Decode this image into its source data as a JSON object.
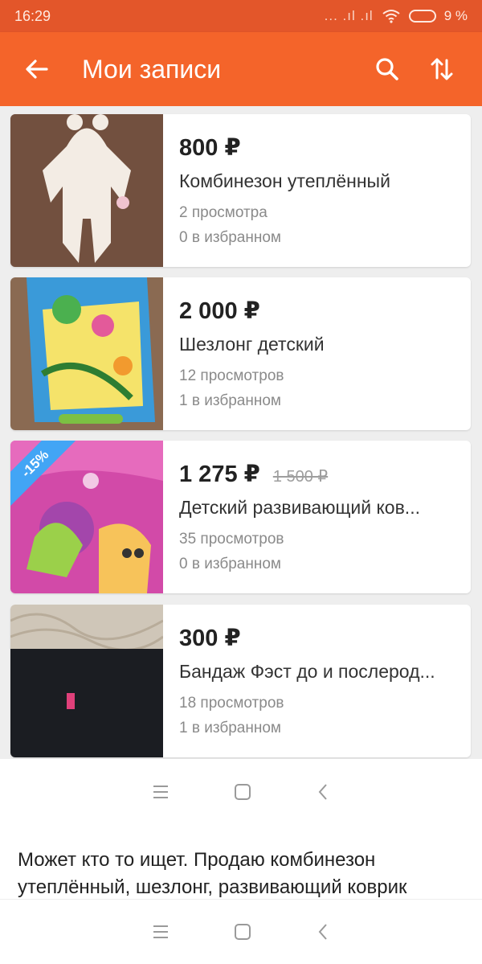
{
  "status_bar": {
    "time": "16:29",
    "signal": "... .ıl .ıl",
    "battery": "9 %"
  },
  "app_bar": {
    "title": "Мои записи",
    "icons": [
      "arrow-back-icon",
      "search-icon",
      "sort-icon"
    ]
  },
  "items": [
    {
      "price": "800 ₽",
      "old_price": "",
      "name": "Комбинезон утеплённый",
      "views": "2 просмотра",
      "favorites": "0 в избранном",
      "discount": ""
    },
    {
      "price": "2 000 ₽",
      "old_price": "",
      "name": "Шезлонг детский",
      "views": "12 просмотров",
      "favorites": "1 в избранном",
      "discount": ""
    },
    {
      "price": "1 275 ₽",
      "old_price": "1 500 ₽",
      "name": "Детский развивающий ков...",
      "views": "35 просмотров",
      "favorites": "0 в избранном",
      "discount": "-15%"
    },
    {
      "price": "300 ₽",
      "old_price": "",
      "name": "Бандаж Фэст до и послерод...",
      "views": "18 просмотров",
      "favorites": "1 в избранном",
      "discount": ""
    }
  ],
  "caption": "Может кто то ищет. Продаю комбинезон утеплённый, шезлонг, развивающий коврик",
  "nav_icons": [
    "menu-icon",
    "home-icon",
    "back-icon"
  ],
  "colors": {
    "accent": "#f4642a",
    "status_bar": "#e3562a",
    "discount_badge": "#42a5f5"
  }
}
